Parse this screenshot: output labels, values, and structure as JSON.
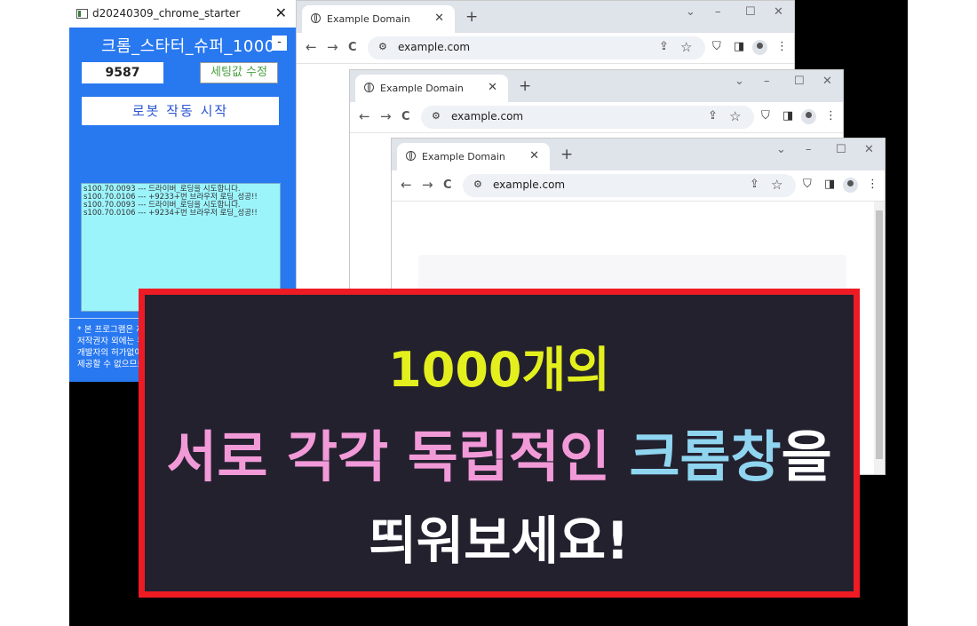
{
  "colors": {
    "stage_bg": "#000000",
    "app_bg": "#2878f0",
    "log_bg": "#9cf4fb",
    "banner_bg": "#24212f",
    "banner_border": "#ee1b24",
    "yellow": "#e4f01e",
    "pink": "#f29ad8",
    "blue": "#8fd5f0"
  },
  "app": {
    "window_title": "d20240309_chrome_starter",
    "close_glyph": "✕",
    "heading": "크롬_스타터_슈퍼_1000",
    "minimize_label": "-",
    "count_value": "9587",
    "settings_button": "세팅값 수정",
    "start_button": "로봇 작동 시작",
    "log_lines": [
      "s100.70.0093 --- 드라이버_로딩을 시도합니다.",
      "s100.70.0106 --- +9233+번 브라우저 로딩_성공!!",
      "s100.70.0093 --- 드라이버_로딩을 시도합니다.",
      "s100.70.0106 --- +9234+번 브라우저 로딩_성공!!"
    ],
    "notice_lines": [
      "* 본 프로그램은 저작권은 개발자에게 있으며,",
      "저작권자 외에는 무단복제 및 재판매가 불가하며,",
      "개발자의 허가없이 타인에게 프로그램 파일을",
      "제공할 수 없으므로 유의바랍니다."
    ]
  },
  "browser": {
    "tab_title": "Example Domain",
    "tab_close": "✕",
    "new_tab": "+",
    "url": "example.com",
    "back_icon": "←",
    "forward_icon": "→",
    "reload_icon": "C",
    "tune_icon": "⚙",
    "share_icon": "⇪",
    "star_icon": "☆",
    "extension_icon": "⛉",
    "sidepanel_icon": "◨",
    "menu_icon": "⋮",
    "chevron_icon": "⌄",
    "minimize_icon": "–",
    "maximize_icon": "☐",
    "close_icon": "✕"
  },
  "banner": {
    "line1": "1000개의",
    "line2_part1": "서로 각각 독립적인 ",
    "line2_part2": "크롬창",
    "line2_part3": "을",
    "line3": "띄워보세요!"
  }
}
